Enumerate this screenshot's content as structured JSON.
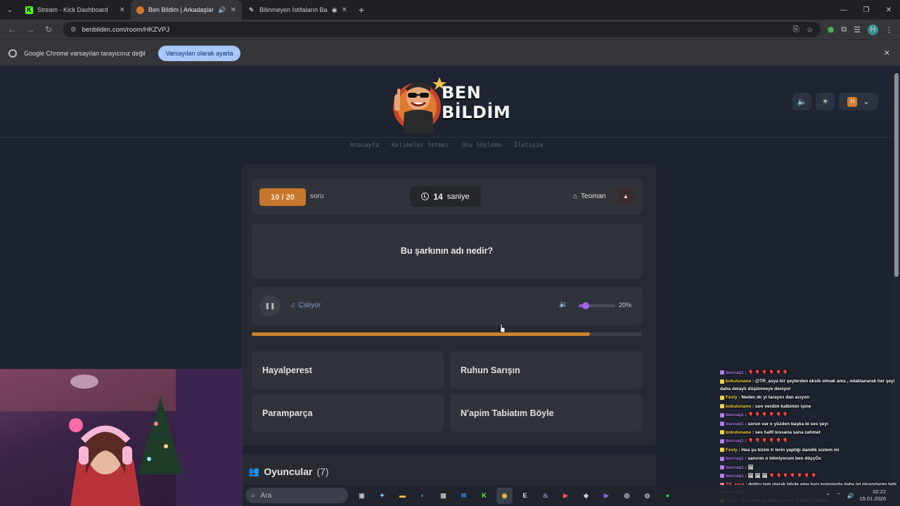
{
  "browser": {
    "tabs": [
      {
        "title": "Stream - Kick Dashboard",
        "favicon": "kick-icon",
        "color": "#53fc18",
        "active": false
      },
      {
        "title": "Ben Bildim | Arkadaşlarınla",
        "favicon": "benbildim-icon",
        "color": "#d07a2c",
        "active": true,
        "muted": true
      },
      {
        "title": "Bilinmeyen İstifaların Başarı",
        "favicon": "edit-icon",
        "color": "#aaaaaa",
        "active": false,
        "recording": true
      }
    ],
    "url": "benbildim.com/room/HKZVPJ",
    "profile_initial": "H",
    "infobar_text": "Google Chrome varsayılan tarayıcınız değil",
    "infobar_button": "Varsayılan olarak ayarla"
  },
  "site": {
    "logo_line1": "BEN",
    "logo_line2": "BİLDİM",
    "user_initial": "H",
    "nav": [
      "Anasayfa",
      "Kelimeler Yetmez",
      "Onu Söyleme",
      "İletişim"
    ]
  },
  "game": {
    "question_progress": "10 / 20",
    "question_word": "soru",
    "timer_value": "14",
    "timer_unit": "saniye",
    "artist": "Teoman",
    "question": "Bu şarkının adı nedir?",
    "playing_label": "Çalıyor",
    "volume": 0.2,
    "volume_label": "20%",
    "song_progress": 0.867,
    "answers": [
      "Hayalperest",
      "Ruhun Sarışın",
      "Paramparça",
      "N'apim Tabiatım Böyle"
    ],
    "players_title": "Oyuncular",
    "players_count": "(7)"
  },
  "chat": [
    {
      "user": "burcuq1",
      "color": "#b57cf0",
      "text": ": 🎈 🎈 🎈 🎈 🎈 🎈"
    },
    {
      "user": "kokulunane",
      "color": "#f5d142",
      "text": ": @TR_asya bir şeylerden eksik olmak ama , odaklanarak her şeyi daha detaylı düşünmeye deniyor",
      "wrap": true
    },
    {
      "user": "Fesly",
      "color": "#f5d142",
      "text": ": Neden dc yi tarayıcı dan acıyon"
    },
    {
      "user": "kokulunane",
      "color": "#f5d142",
      "text": ": son verdim kalbimin işine"
    },
    {
      "user": "burcuq1",
      "color": "#b57cf0",
      "text": ": 🎈 🎈 🎈 🎈 🎈 🎈"
    },
    {
      "user": "burcuq1",
      "color": "#b57cf0",
      "text": ": sorun var o yüzden başka bi ses şeyi"
    },
    {
      "user": "kokulunane",
      "color": "#f5d142",
      "text": ": ses hafif kıssana sana zahmet"
    },
    {
      "user": "burcuq1",
      "color": "#b57cf0",
      "text": ": 🎈 🎈 🎈 🎈 🎈 🎈"
    },
    {
      "user": "Fesly",
      "color": "#f5d142",
      "text": ": Hea şu bizim tr lerin yaptığı dandik sistem mi"
    },
    {
      "user": "burcuq1",
      "color": "#b57cf0",
      "text": ": sanırım o bilmiyorum ben döççÖc"
    },
    {
      "user": "burcuq1",
      "color": "#b57cf0",
      "text": ": 🖼"
    },
    {
      "user": "burcuq1",
      "color": "#b57cf0",
      "text": ": 🖼 🖼 🖼 🎈 🎈 🎈 🎈 🎈 🎈 🎈"
    },
    {
      "user": "TR_asya",
      "color": "#f27c7c",
      "text": ": doğru tam olarak böyle ama bazı konularda daha iyi oluyorlarmı tabi hepsi değil",
      "wrap": true
    },
    {
      "user": "Fesly",
      "color": "#f5d142",
      "text": ": Sorunlar gözüm yazımız. Çözeriz isterse"
    }
  ],
  "taskbar": {
    "search_placeholder": "Ara",
    "time": "02:22",
    "date": "15.01.2026"
  }
}
